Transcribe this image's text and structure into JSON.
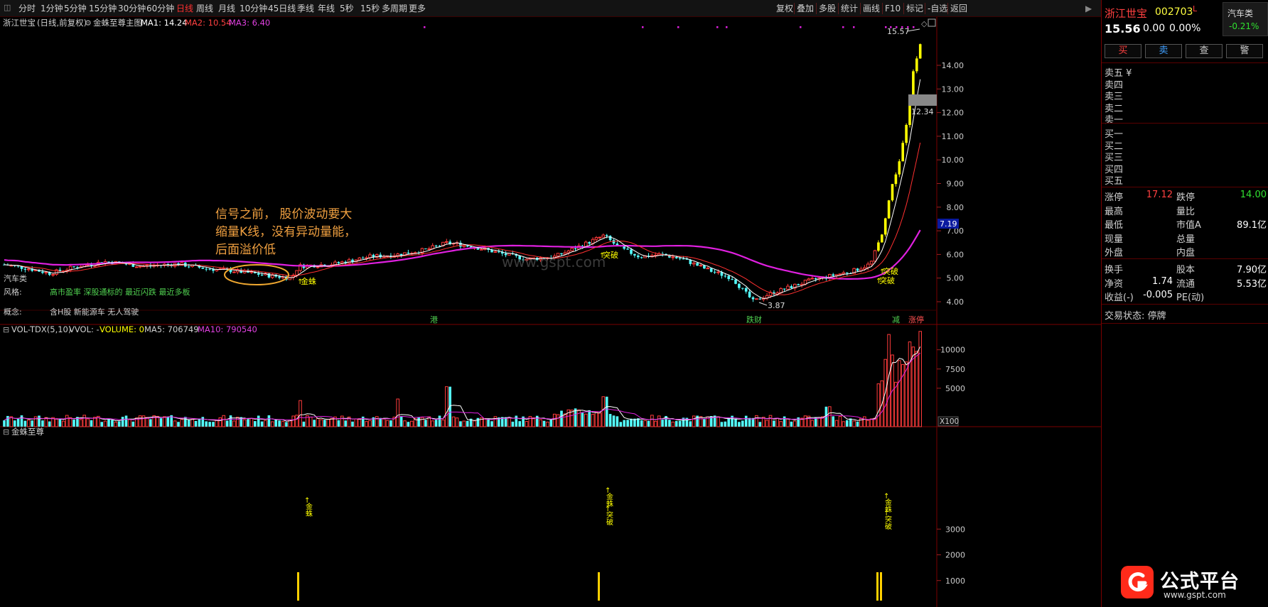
{
  "toolbar": {
    "periods": [
      "分时",
      "1分钟",
      "5分钟",
      "15分钟",
      "30分钟",
      "60分钟",
      "日线",
      "周线",
      "月线",
      "10分钟",
      "45日线",
      "季线",
      "年线",
      "5秒",
      "15秒",
      "多周期",
      "更多"
    ],
    "active_period": "日线",
    "right_tools": [
      "复权",
      "叠加",
      "多股",
      "统计",
      "画线",
      "F10",
      "标记",
      "-自选",
      "返回"
    ]
  },
  "main_header": {
    "stock": "浙江世宝",
    "mode": "(日线,前复权)",
    "indicator": "金蛛至尊主图",
    "ma1": "MA1: 14.24",
    "ma2": "MA2: 10.54",
    "ma3": "MA3: 6.40"
  },
  "side_left": {
    "sector_tag": "汽车类",
    "style_label": "风格:",
    "style_values": "高市盈率  深股通标的  最近闪跌  最近多板",
    "concept_label": "概念:",
    "concept_values": "含H股  新能源车  无人驾驶"
  },
  "annotation": {
    "line1": "信号之前，   股价波动要大",
    "line2": "缩量K线，没有异动量能，",
    "line3": "后面溢价低"
  },
  "price_axis": [
    "14.00",
    "13.00",
    "12.00",
    "11.00",
    "10.00",
    "9.00",
    "8.00",
    "7.00",
    "6.00",
    "5.00",
    "4.00"
  ],
  "price_axis_values": [
    14,
    13,
    12,
    11,
    10,
    9,
    8,
    7,
    6,
    5,
    4
  ],
  "current_price_tag": "7.19",
  "labels": {
    "high": "15.57",
    "low": "3.87",
    "mid": "12.34",
    "jinzhu": "金蛛",
    "tupo": "突破",
    "tupo2": "突破",
    "tupo3": "突破",
    "gang": "港",
    "diecai": "跌财",
    "jian": "减",
    "zhangting": "涨停",
    "watermark": "www.gspt.com"
  },
  "volume_header": {
    "name": "VOL-TDX(5,10)",
    "vvol": "VVOL: -",
    "volume": "VOLUME: 0",
    "ma5": "MA5: 706749",
    "ma10": "MA10: 790540"
  },
  "volume_axis": [
    "10000",
    "7500",
    "5000"
  ],
  "volume_axis_values": [
    10000,
    7500,
    5000
  ],
  "volume_unit": "X100",
  "sub_header": {
    "name": "金蛛至尊"
  },
  "sub_axis": [
    "3000",
    "2000",
    "1000"
  ],
  "sub_axis_values": [
    3000,
    2000,
    1000
  ],
  "sub_signals": {
    "a": "金蛛",
    "b": "金蛛",
    "c": "突破",
    "d": "金蛛",
    "e": "突破"
  },
  "quote": {
    "name": "浙江世宝",
    "code": "002703",
    "sector": "汽车类",
    "price": "15.56",
    "change": "0.00",
    "pct": "0.00%",
    "sector_pct": "-0.21%",
    "buttons": [
      "买",
      "卖",
      "查",
      "警"
    ],
    "asks": [
      "卖五 ¥",
      "卖四",
      "卖三",
      "卖二",
      "卖一"
    ],
    "bids": [
      "买一",
      "买二",
      "买三",
      "买四",
      "买五"
    ],
    "stats": [
      {
        "k1": "涨停",
        "v1": "17.12",
        "k2": "跌停",
        "v2": "14.00"
      },
      {
        "k1": "最高",
        "v1": "",
        "k2": "量比",
        "v2": ""
      },
      {
        "k1": "最低",
        "v1": "",
        "k2": "市值A",
        "v2": "89.1亿"
      },
      {
        "k1": "现量",
        "v1": "",
        "k2": "总量",
        "v2": ""
      },
      {
        "k1": "外盘",
        "v1": "",
        "k2": "内盘",
        "v2": ""
      }
    ],
    "stats2": [
      {
        "k1": "换手",
        "v1": "",
        "k2": "股本",
        "v2": "7.90亿"
      },
      {
        "k1": "净资",
        "v1": "1.74",
        "k2": "流通",
        "v2": "5.53亿"
      },
      {
        "k1": "收益(-)",
        "v1": "-0.005",
        "k2": "PE(动)",
        "v2": ""
      }
    ],
    "status_label": "交易状态: 停牌"
  },
  "logo": {
    "name": "公式平台",
    "url": "www.gspt.com"
  },
  "colors": {
    "up": "#ff3b3b",
    "down": "#54ffff",
    "ma_magenta": "#e020e0",
    "ma_white": "#ffffff",
    "limit_yellow": "#ffff00",
    "accent_red": "#ff2020"
  }
}
